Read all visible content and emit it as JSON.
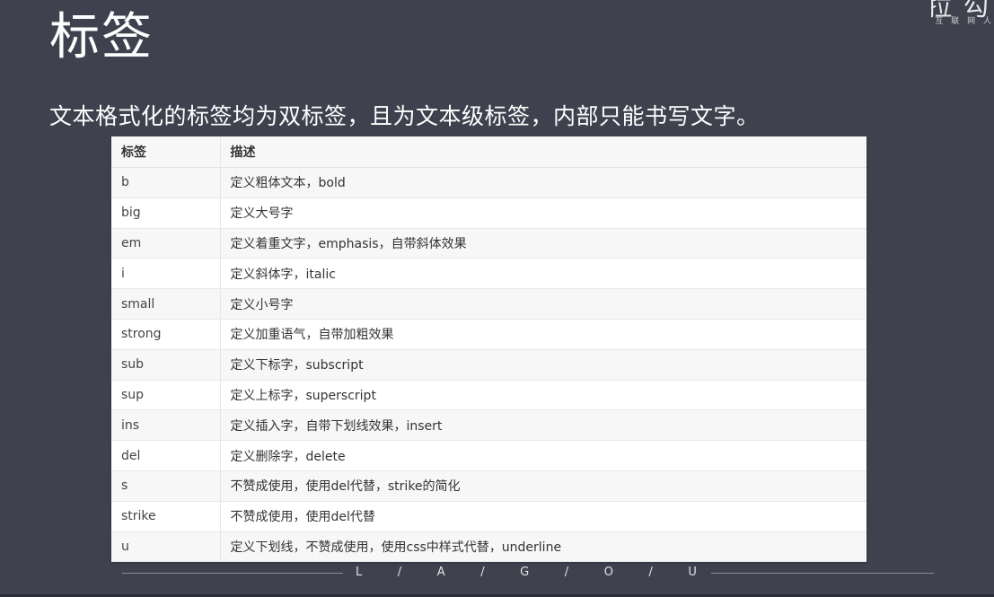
{
  "slide": {
    "title": "标签",
    "subtitle": "文本格式化的标签均为双标签，且为文本级标签，内部只能书写文字。",
    "logo": {
      "mark": "拉 勾",
      "tagline": "— 互 联 网 人"
    }
  },
  "table": {
    "headers": [
      "标签",
      "描述"
    ],
    "rows": [
      {
        "tag": "b",
        "desc": "定义粗体文本，bold"
      },
      {
        "tag": "big",
        "desc": "定义大号字"
      },
      {
        "tag": "em",
        "desc": "定义着重文字，emphasis，自带斜体效果"
      },
      {
        "tag": "i",
        "desc": "定义斜体字，italic"
      },
      {
        "tag": "small",
        "desc": "定义小号字"
      },
      {
        "tag": "strong",
        "desc": "定义加重语气，自带加粗效果"
      },
      {
        "tag": "sub",
        "desc": "定义下标字，subscript"
      },
      {
        "tag": "sup",
        "desc": "定义上标字，superscript"
      },
      {
        "tag": "ins",
        "desc": "定义插入字，自带下划线效果，insert"
      },
      {
        "tag": "del",
        "desc": "定义删除字，delete"
      },
      {
        "tag": "s",
        "desc": "不赞成使用，使用del代替，strike的简化"
      },
      {
        "tag": "strike",
        "desc": "不赞成使用，使用del代替"
      },
      {
        "tag": "u",
        "desc": "定义下划线，不赞成使用，使用css中样式代替，underline"
      }
    ]
  },
  "footer": {
    "letters": [
      "L",
      "/",
      "A",
      "/",
      "G",
      "/",
      "O",
      "/",
      "U"
    ]
  },
  "colors": {
    "background": "#3f424e",
    "table_bg": "#ffffff",
    "row_alt": "#f7f7f7",
    "text_light": "#ffffff"
  }
}
